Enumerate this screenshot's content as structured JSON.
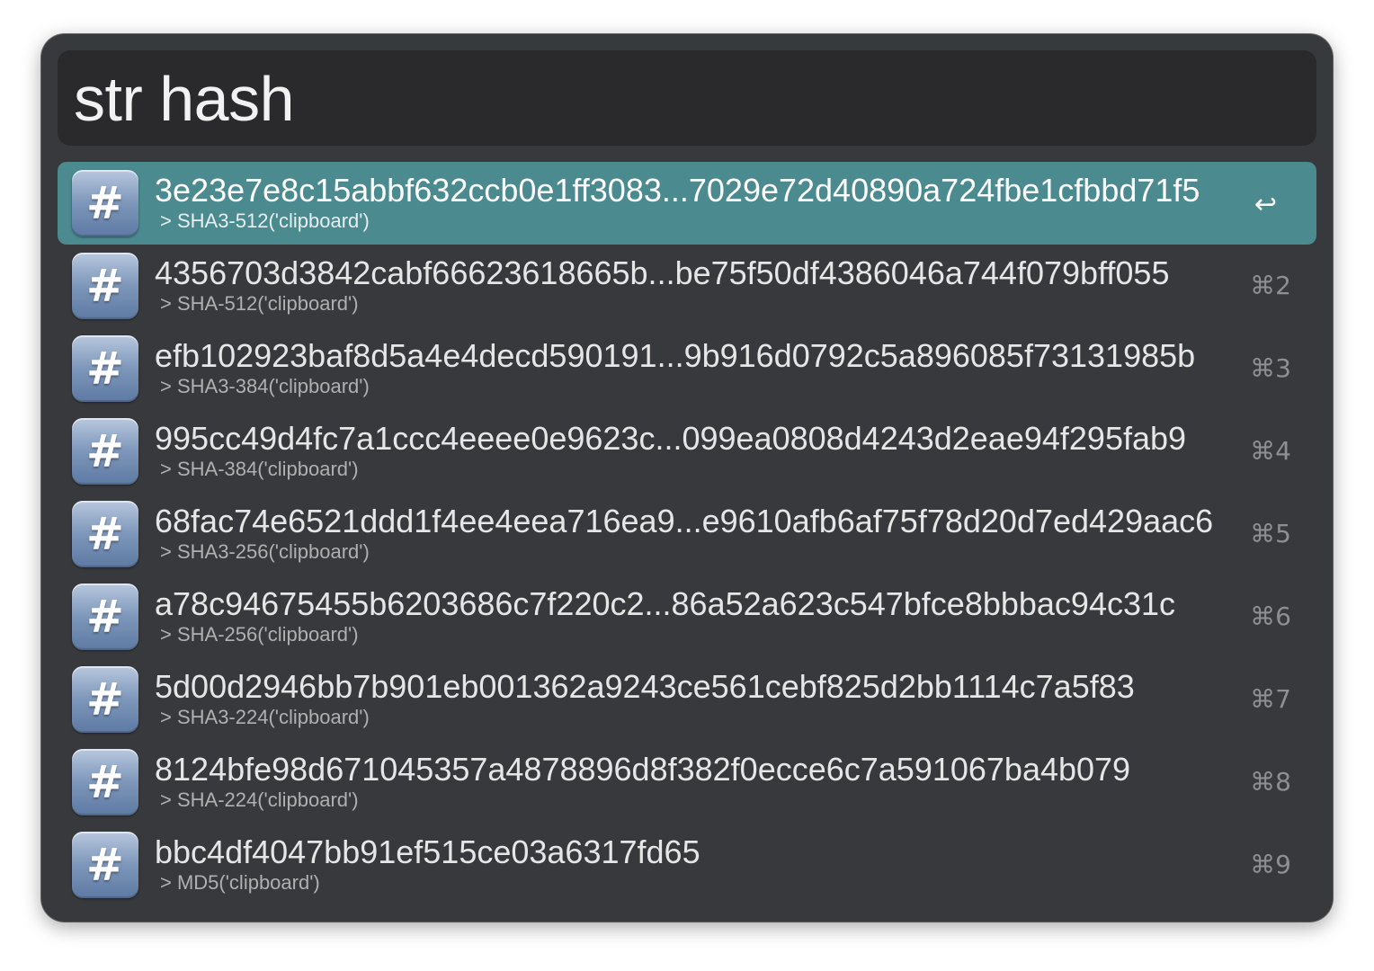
{
  "search": {
    "query": "str hash"
  },
  "results": [
    {
      "title": "3e23e7e8c15abbf632ccb0e1ff3083...7029e72d40890a724fbe1cfbbd71f5",
      "subtitle": "> SHA3-512('clipboard')",
      "shortcut": "↩",
      "icon": "hash-icon"
    },
    {
      "title": "4356703d3842cabf66623618665b...be75f50df4386046a744f079bff055",
      "subtitle": "> SHA-512('clipboard')",
      "shortcut": "⌘2",
      "icon": "hash-icon"
    },
    {
      "title": "efb102923baf8d5a4e4decd590191...9b916d0792c5a896085f73131985b",
      "subtitle": "> SHA3-384('clipboard')",
      "shortcut": "⌘3",
      "icon": "hash-icon"
    },
    {
      "title": "995cc49d4fc7a1ccc4eeee0e9623c...099ea0808d4243d2eae94f295fab9",
      "subtitle": "> SHA-384('clipboard')",
      "shortcut": "⌘4",
      "icon": "hash-icon"
    },
    {
      "title": "68fac74e6521ddd1f4ee4eea716ea9...e9610afb6af75f78d20d7ed429aac6",
      "subtitle": "> SHA3-256('clipboard')",
      "shortcut": "⌘5",
      "icon": "hash-icon"
    },
    {
      "title": "a78c94675455b6203686c7f220c2...86a52a623c547bfce8bbbac94c31c",
      "subtitle": "> SHA-256('clipboard')",
      "shortcut": "⌘6",
      "icon": "hash-icon"
    },
    {
      "title": "5d00d2946bb7b901eb001362a9243ce561cebf825d2bb1114c7a5f83",
      "subtitle": "> SHA3-224('clipboard')",
      "shortcut": "⌘7",
      "icon": "hash-icon"
    },
    {
      "title": "8124bfe98d671045357a4878896d8f382f0ecce6c7a591067ba4b079",
      "subtitle": "> SHA-224('clipboard')",
      "shortcut": "⌘8",
      "icon": "hash-icon"
    },
    {
      "title": "bbc4df4047bb91ef515ce03a6317fd65",
      "subtitle": "> MD5('clipboard')",
      "shortcut": "⌘9",
      "icon": "hash-icon"
    }
  ],
  "icon_glyph": "#",
  "colors": {
    "window_bg": "#38393c",
    "search_bg": "#2a2a2c",
    "selected_row": "#4b8a8f"
  }
}
